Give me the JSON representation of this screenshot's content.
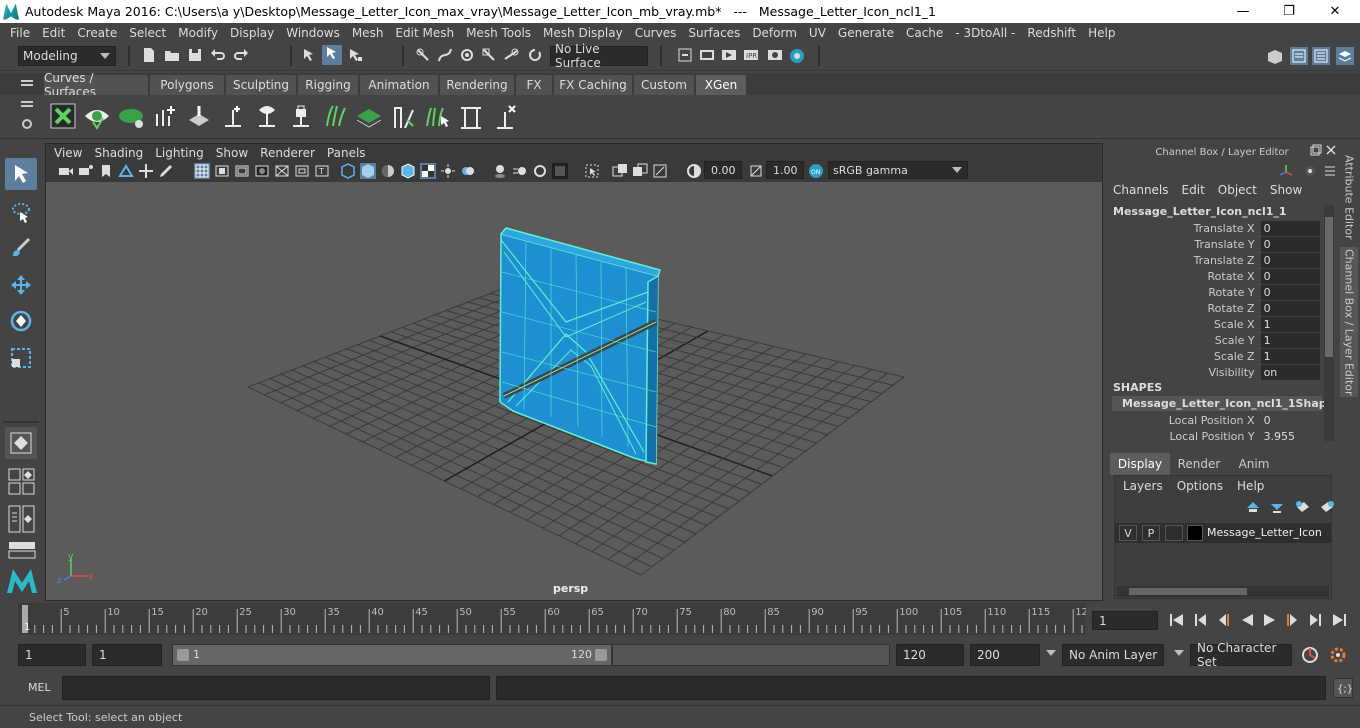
{
  "titlebar": {
    "title": "Autodesk Maya 2016: C:\\Users\\a y\\Desktop\\Message_Letter_Icon_max_vray\\Message_Letter_Icon_mb_vray.mb*   ---   Message_Letter_Icon_ncl1_1",
    "minimize": "—",
    "maximize": "❐",
    "close": "✕"
  },
  "menubar": [
    "File",
    "Edit",
    "Create",
    "Select",
    "Modify",
    "Display",
    "Windows",
    "Mesh",
    "Edit Mesh",
    "Mesh Tools",
    "Mesh Display",
    "Curves",
    "Surfaces",
    "Deform",
    "UV",
    "Generate",
    "Cache",
    "- 3DtoAll -",
    "Redshift",
    "Help"
  ],
  "statusline": {
    "mode": "Modeling",
    "live_surface": "No Live Surface"
  },
  "shelf_tabs": [
    "Curves / Surfaces",
    "Polygons",
    "Sculpting",
    "Rigging",
    "Animation",
    "Rendering",
    "FX",
    "FX Caching",
    "Custom",
    "XGen"
  ],
  "shelf_active": "XGen",
  "viewport": {
    "menu": [
      "View",
      "Shading",
      "Lighting",
      "Show",
      "Renderer",
      "Panels"
    ],
    "exposure": "0.00",
    "gamma": "1.00",
    "colorspace": "sRGB gamma",
    "camera": "persp"
  },
  "channelbox": {
    "header": "Channel Box / Layer Editor",
    "menu": [
      "Channels",
      "Edit",
      "Object",
      "Show"
    ],
    "object": "Message_Letter_Icon_ncl1_1",
    "attrs": [
      {
        "label": "Translate X",
        "value": "0"
      },
      {
        "label": "Translate Y",
        "value": "0"
      },
      {
        "label": "Translate Z",
        "value": "0"
      },
      {
        "label": "Rotate X",
        "value": "0"
      },
      {
        "label": "Rotate Y",
        "value": "0"
      },
      {
        "label": "Rotate Z",
        "value": "0"
      },
      {
        "label": "Scale X",
        "value": "1"
      },
      {
        "label": "Scale Y",
        "value": "1"
      },
      {
        "label": "Scale Z",
        "value": "1"
      },
      {
        "label": "Visibility",
        "value": "on"
      }
    ],
    "shapes_label": "SHAPES",
    "shape_name": "Message_Letter_Icon_ncl1_1Shape",
    "shape_attrs": [
      {
        "label": "Local Position X",
        "value": "0"
      },
      {
        "label": "Local Position Y",
        "value": "3.955"
      }
    ]
  },
  "layer_editor": {
    "tabs": [
      "Display",
      "Render",
      "Anim"
    ],
    "active_tab": "Display",
    "menu": [
      "Layers",
      "Options",
      "Help"
    ],
    "layer": {
      "v": "V",
      "p": "P",
      "name": "Message_Letter_Icon"
    }
  },
  "side_tabs": [
    "Attribute Editor",
    "Channel Box / Layer Editor"
  ],
  "timeline": {
    "ticks": [
      "5",
      "10",
      "15",
      "20",
      "25",
      "30",
      "35",
      "40",
      "45",
      "50",
      "55",
      "60",
      "65",
      "70",
      "75",
      "80",
      "85",
      "90",
      "95",
      "100",
      "105",
      "110",
      "115",
      "12"
    ],
    "current_frame_marker": "1",
    "current_frame_field": "1"
  },
  "range": {
    "start": "1",
    "start_inner": "1",
    "slider_start": "1",
    "slider_end": "120",
    "end_inner": "120",
    "end": "200",
    "anim_layer": "No Anim Layer",
    "char_set": "No Character Set"
  },
  "cmdline": {
    "label": "MEL"
  },
  "helpline": {
    "text": "Select Tool: select an object"
  },
  "colors": {
    "wire": "#5ef0d8",
    "mesh": "#1e8fd0",
    "accent": "#5e7e9e"
  }
}
